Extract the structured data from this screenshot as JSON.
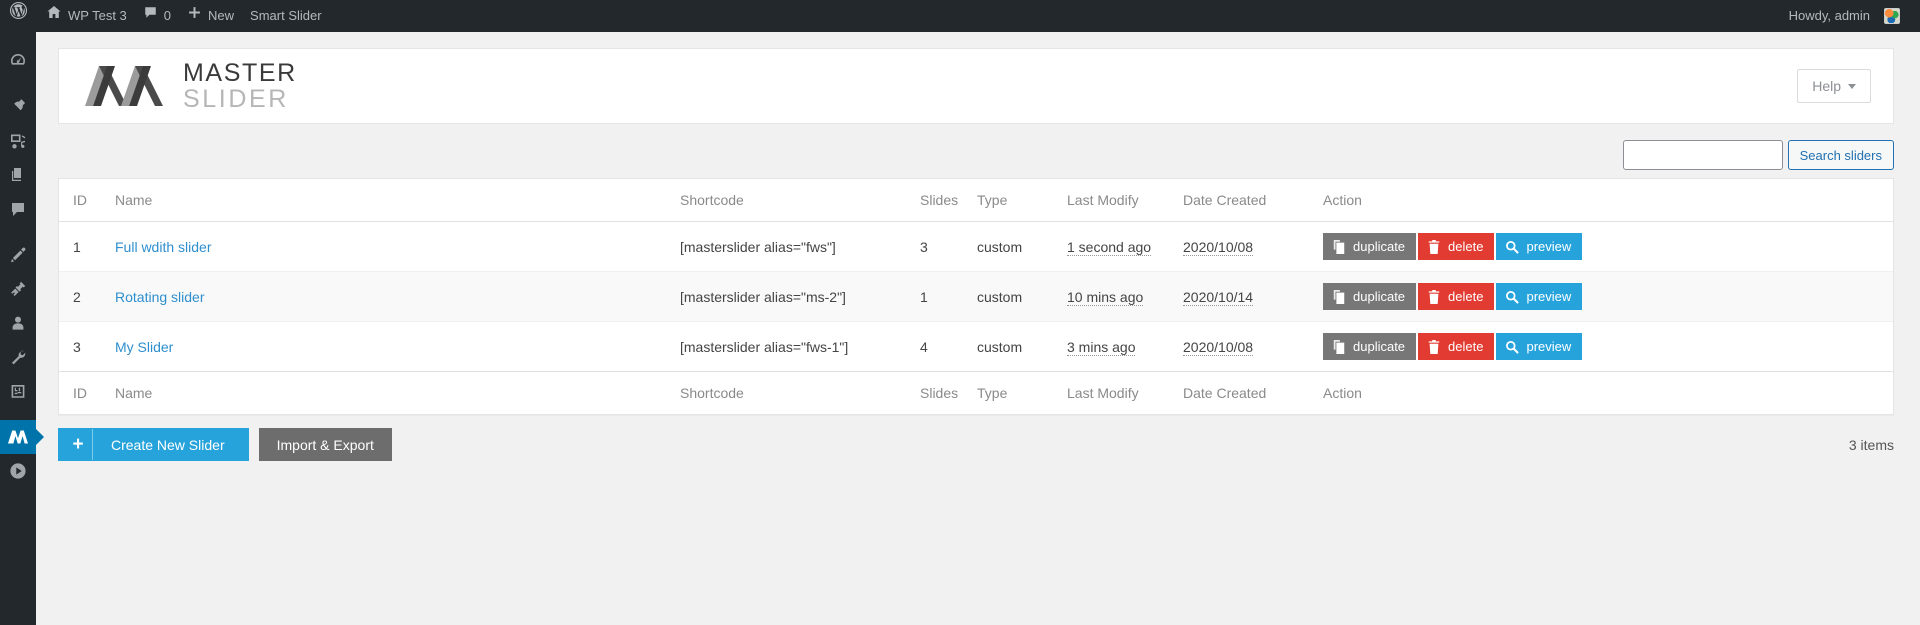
{
  "adminbar": {
    "logo_icon": "wordpress-logo-icon",
    "site_name": "WP Test 3",
    "comments_icon": "comment-bubble-icon",
    "comments_count": "0",
    "new_label": "New",
    "smart_slider_label": "Smart Slider",
    "howdy": "Howdy, admin",
    "bg": "#23282d"
  },
  "sidebar": {
    "items": [
      {
        "name": "dashboard",
        "icon": "dashboard-icon"
      },
      {
        "name": "posts",
        "icon": "pin-icon"
      },
      {
        "name": "media",
        "icon": "media-icon"
      },
      {
        "name": "pages",
        "icon": "pages-icon"
      },
      {
        "name": "comments",
        "icon": "comment-bubble-icon"
      },
      {
        "name": "appearance",
        "icon": "paintbrush-icon"
      },
      {
        "name": "plugins",
        "icon": "plug-icon"
      },
      {
        "name": "users",
        "icon": "user-icon"
      },
      {
        "name": "tools",
        "icon": "wrench-icon"
      },
      {
        "name": "settings",
        "icon": "sliders-settings-icon"
      },
      {
        "name": "master-slider",
        "icon": "master-slider-m-icon",
        "current": true
      },
      {
        "name": "smart-slider",
        "icon": "play-circle-icon"
      }
    ],
    "active_color": "#0073aa"
  },
  "header": {
    "logo_icon": "master-slider-logo-icon",
    "wordmark_top": "MASTER",
    "wordmark_bottom": "SLIDER",
    "help_label": "Help",
    "help_caret_icon": "caret-down-icon"
  },
  "search": {
    "value": "",
    "placeholder": "",
    "button_label": "Search sliders",
    "accent": "#2271b1"
  },
  "table": {
    "columns": [
      "ID",
      "Name",
      "Shortcode",
      "Slides",
      "Type",
      "Last Modify",
      "Date Created",
      "Action"
    ],
    "rows": [
      {
        "id": "1",
        "name": "Full wdith slider",
        "shortcode": "[masterslider alias=\"fws\"]",
        "slides": "3",
        "type": "custom",
        "last_modify": "1 second ago",
        "date_created": "2020/10/08"
      },
      {
        "id": "2",
        "name": "Rotating slider",
        "shortcode": "[masterslider alias=\"ms-2\"]",
        "slides": "1",
        "type": "custom",
        "last_modify": "10 mins ago",
        "date_created": "2020/10/14"
      },
      {
        "id": "3",
        "name": "My Slider",
        "shortcode": "[masterslider alias=\"fws-1\"]",
        "slides": "4",
        "type": "custom",
        "last_modify": "3 mins ago",
        "date_created": "2020/10/08"
      }
    ],
    "actions": {
      "duplicate_label": "duplicate",
      "duplicate_icon": "copy-icon",
      "duplicate_color": "#777777",
      "delete_label": "delete",
      "delete_icon": "trash-icon",
      "delete_color": "#e13b32",
      "preview_label": "preview",
      "preview_icon": "magnifier-icon",
      "preview_color": "#27a3dc"
    }
  },
  "footer": {
    "create_label": "Create New Slider",
    "create_icon": "plus-icon",
    "create_color": "#27a3dc",
    "import_label": "Import & Export",
    "import_color": "#6d6d6d",
    "items_count": "3 items"
  }
}
